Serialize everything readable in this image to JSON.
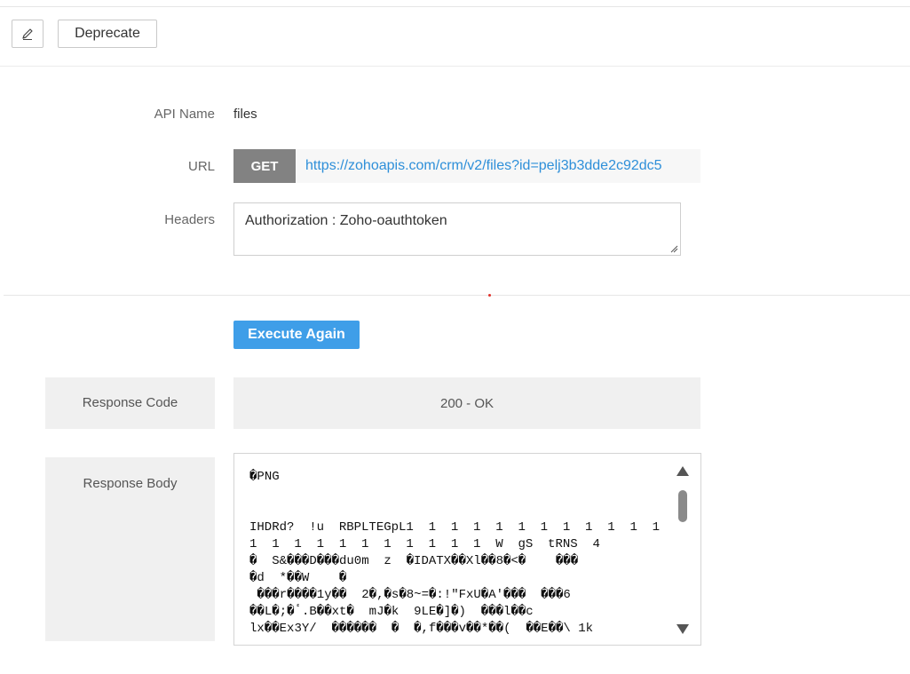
{
  "toolbar": {
    "edit_icon": "pencil-icon",
    "deprecate_label": "Deprecate"
  },
  "form": {
    "api_name_label": "API Name",
    "api_name_value": "files",
    "url_label": "URL",
    "method": "GET",
    "url_value": "https://zohoapis.com/crm/v2/files?id=pelj3b3dde2c92dc5",
    "headers_label": "Headers",
    "headers_value": "Authorization : Zoho-oauthtoken"
  },
  "actions": {
    "execute_label": "Execute Again"
  },
  "response": {
    "code_label": "Response Code",
    "code_value": "200 - OK",
    "body_label": "Response Body",
    "body_value": "�PNG\n\n\nIHDRd?  !u  RBPLTEGpL1  1  1  1  1  1  1  1  1  1  1  1  1  1  1  1  1  1  1  1  1  1  1  W  gS  tRNS  4\n�  S&���D���du0m  z  �IDATX��Xl��8�<�    ���\n�d  *��W    �\n ���r����1y��  2�,�s�8~=�:!\"FxU�A'���  ���6\n��L�;�ٴ.B��xt�  mJ�k  9LE�]�)  ���l��c\nlx��Ex3Y/  ������  �  �,f���v��*��(  ��E��\\ 1k"
  },
  "colors": {
    "accent": "#3f9ee8",
    "link": "#2e8fd9",
    "method_badge": "#828282"
  }
}
